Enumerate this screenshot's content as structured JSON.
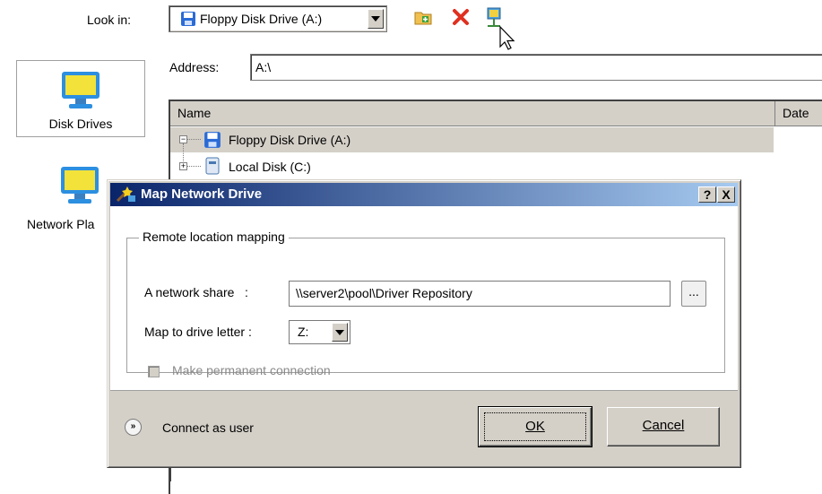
{
  "browser": {
    "look_in_label": "Look in:",
    "look_in_value": "Floppy Disk Drive (A:)",
    "address_label": "Address:",
    "address_value": "A:\\",
    "sidebar": [
      {
        "label": "Disk Drives",
        "icon": "computer-icon"
      },
      {
        "label": "Network Pla",
        "icon": "network-computer-icon"
      }
    ],
    "toolbar_icons": [
      "new-folder-icon",
      "delete-icon",
      "map-network-drive-icon"
    ],
    "columns": [
      "Name",
      "Date"
    ],
    "tree": [
      {
        "label": "Floppy Disk Drive (A:)",
        "icon": "floppy-icon",
        "expander": "−",
        "selected": true
      },
      {
        "label": "Local Disk (C:)",
        "icon": "hard-disk-icon",
        "expander": "+",
        "selected": false
      }
    ]
  },
  "dialog": {
    "title": "Map Network Drive",
    "help_button": "?",
    "close_button": "X",
    "group_title": "Remote location mapping",
    "share_label": "A network share   :",
    "share_value": "\\\\server2\\pool\\Driver Repository",
    "browse_label": "...",
    "letter_label": "Map to drive letter :",
    "letter_value": "Z:",
    "permanent_label": "Make permanent connection",
    "permanent_checked": false,
    "connect_label": "Connect as user",
    "ok_label": "OK",
    "cancel_label": "Cancel"
  },
  "colors": {
    "title_start": "#0a246a",
    "title_end": "#a6caf0",
    "face": "#d4d0c8"
  }
}
